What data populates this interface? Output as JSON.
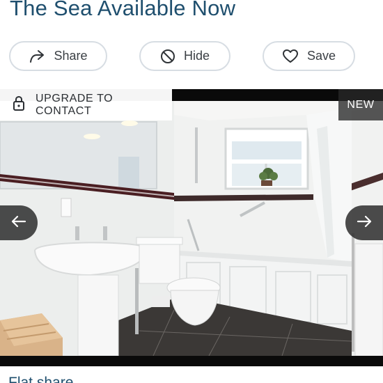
{
  "listing": {
    "title": "The Sea Available Now"
  },
  "actions": {
    "share_label": "Share",
    "hide_label": "Hide",
    "save_label": "Save",
    "share_icon": "share-arrow-icon",
    "hide_icon": "block-circle-icon",
    "save_icon": "heart-icon"
  },
  "photo": {
    "upgrade_label": "UPGRADE TO CONTACT",
    "upgrade_icon": "lock-icon",
    "badge_label": "NEW",
    "prev_icon": "arrow-left-icon",
    "next_icon": "arrow-right-icon"
  },
  "next_section": {
    "title": "Flat share"
  },
  "colors": {
    "title": "#1f4f6e",
    "button_border": "#d7dde3",
    "photo_frame": "#0a0a0a"
  }
}
